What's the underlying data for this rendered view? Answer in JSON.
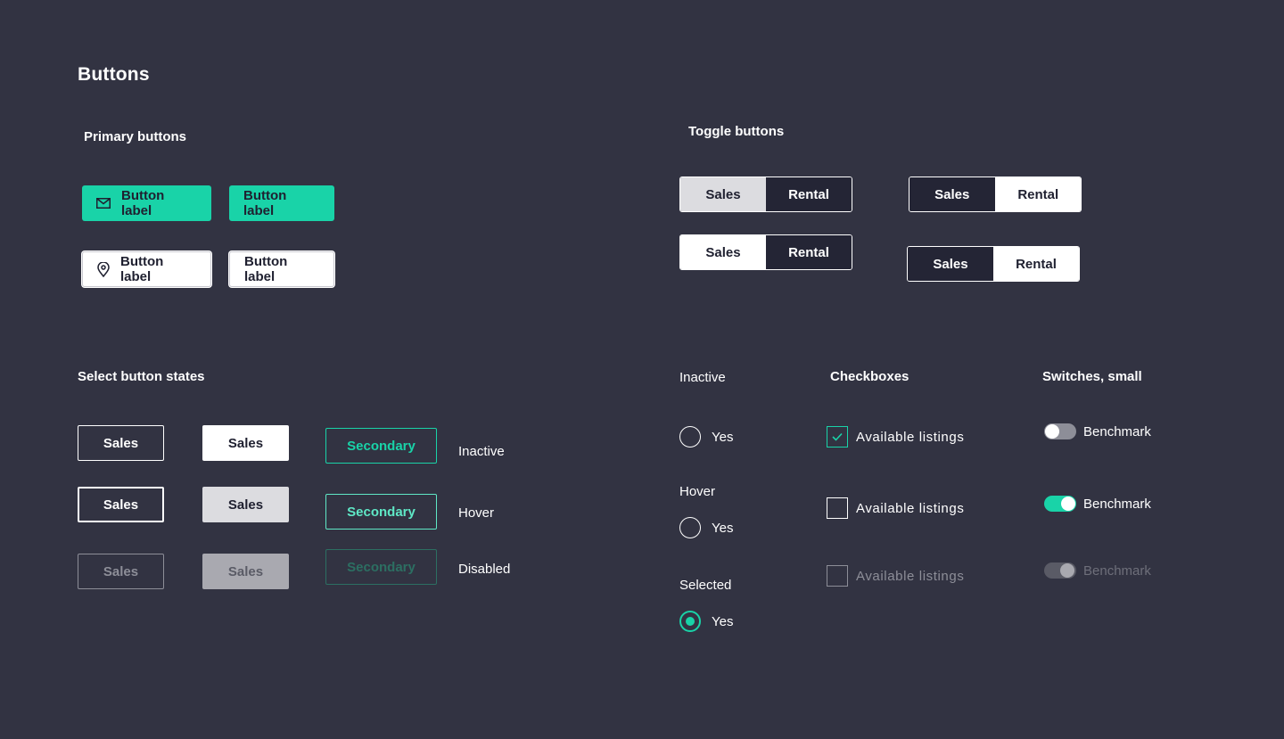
{
  "page_title": "Buttons",
  "primary": {
    "heading": "Primary buttons",
    "buttons": [
      {
        "label": "Button label",
        "icon": "mail-icon"
      },
      {
        "label": "Button label"
      },
      {
        "label": "Button label",
        "icon": "location-pin-icon"
      },
      {
        "label": "Button label"
      }
    ]
  },
  "toggles": {
    "heading": "Toggle buttons",
    "groups": [
      {
        "left": "Sales",
        "right": "Rental"
      },
      {
        "left": "Sales",
        "right": "Rental"
      },
      {
        "left": "Sales",
        "right": "Rental"
      },
      {
        "left": "Sales",
        "right": "Rental"
      }
    ]
  },
  "select": {
    "heading": "Select button states",
    "outline": [
      "Sales",
      "Sales",
      "Sales"
    ],
    "filled": [
      "Sales",
      "Sales",
      "Sales"
    ],
    "secondary": [
      "Secondary",
      "Secondary",
      "Secondary"
    ],
    "states": [
      "Inactive",
      "Hover",
      "Disabled"
    ]
  },
  "radios": {
    "items": [
      {
        "state": "Inactive",
        "label": "Yes"
      },
      {
        "state": "Hover",
        "label": "Yes"
      },
      {
        "state": "Selected",
        "label": "Yes"
      }
    ]
  },
  "checkboxes": {
    "heading": "Checkboxes",
    "items": [
      {
        "label": "Available listings",
        "checked": true
      },
      {
        "label": "Available listings",
        "checked": false
      },
      {
        "label": "Available listings",
        "checked": false,
        "disabled": true
      }
    ]
  },
  "switches": {
    "heading": "Switches, small",
    "items": [
      {
        "label": "Benchmark",
        "on": false
      },
      {
        "label": "Benchmark",
        "on": true
      },
      {
        "label": "Benchmark",
        "on": true,
        "disabled": true
      }
    ]
  },
  "colors": {
    "background": "#323342",
    "accent": "#19d3a8",
    "dark": "#242535"
  }
}
